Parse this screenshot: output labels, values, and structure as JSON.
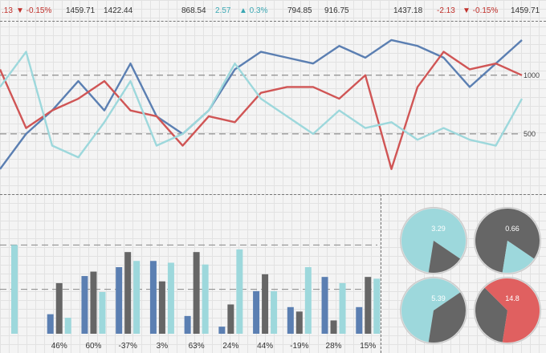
{
  "ticker": [
    {
      "text": ".13",
      "tone": "neg"
    },
    {
      "text": "▼ -0.15%",
      "tone": "neg"
    },
    {
      "text": "1459.71",
      "tone": "normal"
    },
    {
      "text": "1422.44",
      "tone": "normal"
    },
    {
      "text": "868.54",
      "tone": "normal"
    },
    {
      "text": "2.57",
      "tone": "pos"
    },
    {
      "text": "▲ 0.3%",
      "tone": "pos"
    },
    {
      "text": "794.85",
      "tone": "normal"
    },
    {
      "text": "916.75",
      "tone": "normal"
    },
    {
      "text": "1437.18",
      "tone": "normal"
    },
    {
      "text": "-2.13",
      "tone": "neg"
    },
    {
      "text": "▼ -0.15%",
      "tone": "neg"
    },
    {
      "text": "1459.71",
      "tone": "normal"
    }
  ],
  "colors": {
    "blue": "#5b7fb2",
    "red": "#d05555",
    "cyan": "#9dd8dc",
    "gray": "#666666",
    "pie_red": "#e06060"
  },
  "chart_data": [
    {
      "type": "line",
      "y_ticks": [
        500,
        1000
      ],
      "ylim": [
        0,
        1450
      ],
      "x": [
        0,
        5,
        10,
        15,
        20,
        25,
        30,
        35,
        40,
        45,
        50,
        55,
        60,
        65,
        70,
        75,
        80,
        85,
        90,
        95,
        100
      ],
      "series": [
        {
          "color": "blue",
          "values": [
            200,
            500,
            700,
            950,
            700,
            1100,
            650,
            500,
            700,
            1050,
            1200,
            1150,
            1100,
            1250,
            1150,
            1300,
            1250,
            1150,
            900,
            1100,
            1300
          ]
        },
        {
          "color": "red",
          "values": [
            1050,
            550,
            700,
            800,
            950,
            700,
            650,
            400,
            650,
            600,
            850,
            900,
            900,
            800,
            1000,
            200,
            900,
            1200,
            1050,
            1100,
            1000
          ]
        },
        {
          "color": "cyan",
          "values": [
            900,
            1200,
            400,
            300,
            600,
            950,
            400,
            500,
            700,
            1100,
            800,
            650,
            500,
            700,
            550,
            600,
            450,
            550,
            450,
            400,
            800
          ]
        }
      ]
    },
    {
      "type": "bar",
      "categories": [
        "",
        "46%",
        "60%",
        "-37%",
        "3%",
        "63%",
        "24%",
        "44%",
        "-19%",
        "28%",
        "15%"
      ],
      "ylim": [
        0,
        150
      ],
      "series": [
        {
          "color": "blue",
          "values": [
            0,
            22,
            65,
            75,
            82,
            20,
            8,
            48,
            30,
            64,
            30
          ]
        },
        {
          "color": "gray",
          "values": [
            0,
            57,
            70,
            92,
            59,
            92,
            33,
            67,
            25,
            15,
            64
          ]
        },
        {
          "color": "cyan",
          "values": [
            100,
            18,
            47,
            82,
            80,
            78,
            95,
            48,
            75,
            57,
            62
          ]
        }
      ]
    },
    {
      "type": "pie",
      "charts": [
        {
          "label": "3.29",
          "slices": [
            {
              "color": "cyan",
              "value": 0.82
            },
            {
              "color": "gray",
              "value": 0.18
            }
          ]
        },
        {
          "label": "0.66",
          "slices": [
            {
              "color": "gray",
              "value": 0.82
            },
            {
              "color": "cyan",
              "value": 0.18
            }
          ]
        },
        {
          "label": "5.39",
          "slices": [
            {
              "color": "cyan",
              "value": 0.63
            },
            {
              "color": "gray",
              "value": 0.37
            }
          ]
        },
        {
          "label": "14.8",
          "slices": [
            {
              "color": "gray",
              "value": 0.35
            },
            {
              "color": "pie_red",
              "value": 0.65
            }
          ]
        }
      ]
    }
  ]
}
